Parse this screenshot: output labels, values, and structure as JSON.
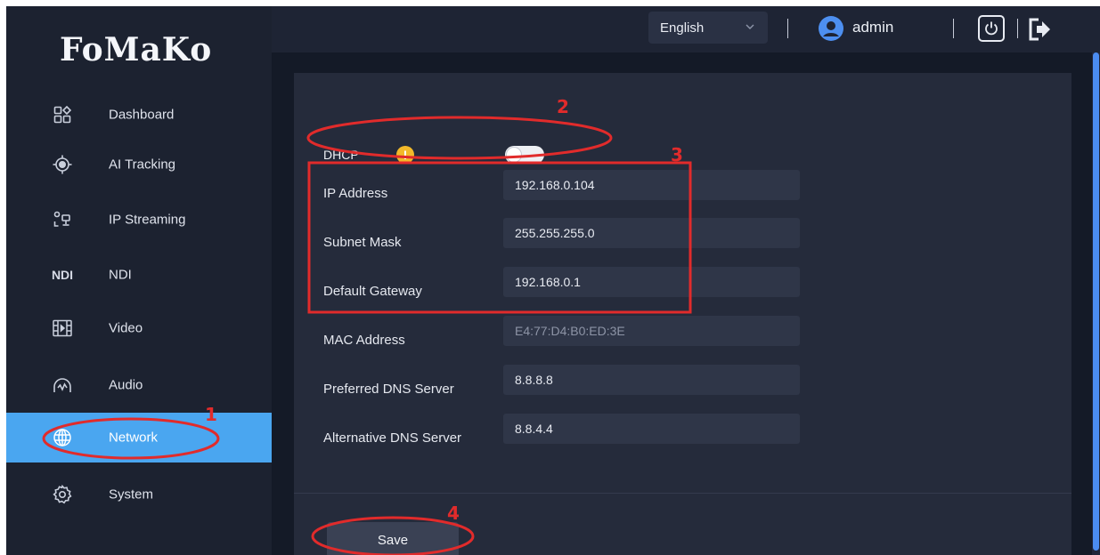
{
  "brand": {
    "logo_text": "FoMaKo"
  },
  "sidebar": {
    "items": [
      {
        "label": "Dashboard",
        "icon": "dashboard-grid-icon"
      },
      {
        "label": "AI Tracking",
        "icon": "target-icon"
      },
      {
        "label": "IP Streaming",
        "icon": "ip-streaming-icon"
      },
      {
        "label": "NDI",
        "icon": "ndi-icon",
        "icon_text": "NDI"
      },
      {
        "label": "Video",
        "icon": "film-icon"
      },
      {
        "label": "Audio",
        "icon": "audio-icon"
      },
      {
        "label": "Network",
        "icon": "globe-icon",
        "active": true
      },
      {
        "label": "System",
        "icon": "gear-icon"
      }
    ]
  },
  "header": {
    "language": "English",
    "username": "admin"
  },
  "network_form": {
    "dhcp_label": "DHCP",
    "dhcp_enabled": false,
    "info_glyph": "!",
    "fields": [
      {
        "label": "IP Address",
        "value": "192.168.0.104"
      },
      {
        "label": "Subnet Mask",
        "value": "255.255.255.0"
      },
      {
        "label": "Default Gateway",
        "value": "192.168.0.1"
      },
      {
        "label": "MAC Address",
        "value": "E4:77:D4:B0:ED:3E",
        "readonly": true
      },
      {
        "label": "Preferred DNS Server",
        "value": "8.8.8.8"
      },
      {
        "label": "Alternative DNS Server",
        "value": "8.8.4.4"
      }
    ],
    "save_label": "Save"
  },
  "annotations": {
    "step_1": "1",
    "step_2": "2",
    "step_3": "3",
    "step_4": "4"
  },
  "colors": {
    "accent": "#4aa6f0",
    "annotation": "#e12b2b",
    "warning": "#f2b92a"
  }
}
